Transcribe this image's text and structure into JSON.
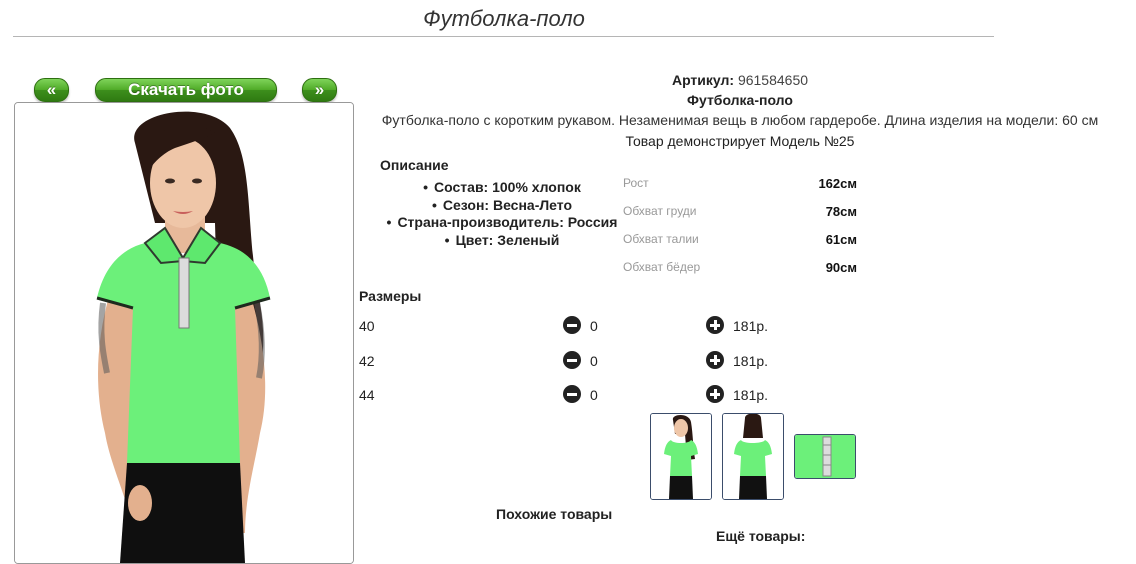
{
  "page": {
    "title": "Футболка-поло"
  },
  "gallery": {
    "prev_label": "«",
    "next_label": "»",
    "download_label": "Скачать фото"
  },
  "product": {
    "article_label": "Артикул:",
    "article_value": "961584650",
    "name": "Футболка-поло",
    "description": "Футболка-поло с коротким рукавом. Незаменимая вещь в любом гардеробе. Длина изделия на модели: 60 см",
    "model_line": "Товар демонстрирует Модель №25"
  },
  "details": {
    "heading": "Описание",
    "items": [
      "Состав: 100% хлопок",
      "Сезон: Весна-Лето",
      "Страна-производитель: Россия",
      "Цвет: Зеленый"
    ]
  },
  "measurements": [
    {
      "label": "Рост",
      "value": "162см"
    },
    {
      "label": "Обхват груди",
      "value": "78см"
    },
    {
      "label": "Обхват талии",
      "value": "61см"
    },
    {
      "label": "Обхват бёдер",
      "value": "90см"
    }
  ],
  "sizes": {
    "heading": "Размеры",
    "rows": [
      {
        "size": "40",
        "qty": "0",
        "price": "181р."
      },
      {
        "size": "42",
        "qty": "0",
        "price": "181р."
      },
      {
        "size": "44",
        "qty": "0",
        "price": "181р."
      }
    ]
  },
  "footer": {
    "similar_label": "Похожие товары",
    "more_label": "Ещё товары:"
  },
  "colors": {
    "button_green": "#4faa27",
    "shirt_green": "#6cf07a",
    "thumb_border": "#3b4d6b"
  }
}
